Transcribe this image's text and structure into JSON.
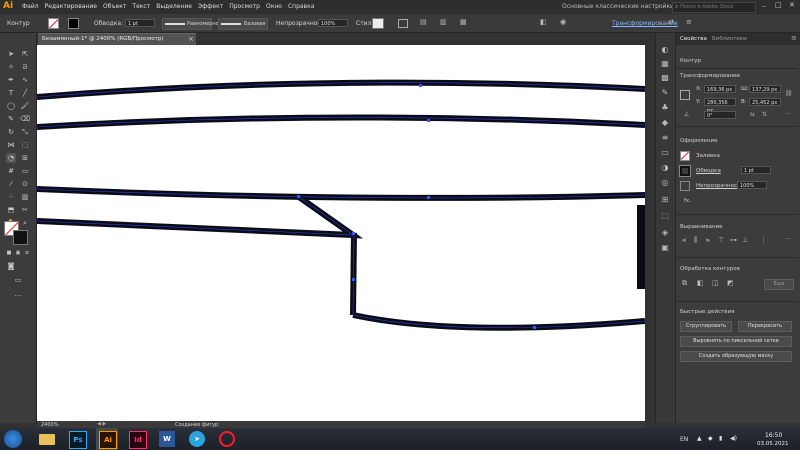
{
  "app": {
    "logo": "Ai",
    "workspace": "Основные классические настройки",
    "search_placeholder": "Поиск в Adobe Stock"
  },
  "menu": [
    "Файл",
    "Редактирование",
    "Объект",
    "Текст",
    "Выделение",
    "Эффект",
    "Просмотр",
    "Окно",
    "Справка"
  ],
  "control_bar": {
    "selection_label": "Контур",
    "stroke_label": "Обводка:",
    "stroke_weight": "1 pt",
    "profile_label": "Равномерно",
    "brush_label": "Базовая",
    "opacity_label": "Непрозрачность:",
    "opacity_value": "100%",
    "style_label": "Стиль:",
    "transform_label": "Трансформирование"
  },
  "document_tab": {
    "title": "Безымянный-1* @ 2400% (RGB/Просмотр)",
    "close": "×"
  },
  "status_bar": {
    "zoom": "2400%",
    "tool": "Создание фигур"
  },
  "panel": {
    "tabs": [
      "Свойства",
      "Библиотеки"
    ],
    "selection": "Контур",
    "transform_title": "Трансформирование",
    "x_label": "X:",
    "x_value": "169,36 px",
    "y_label": "Y:",
    "y_value": "280,356 px",
    "w_label": "Ш:",
    "w_value": "137,29 px",
    "h_label": "В:",
    "h_value": "25,452 px",
    "angle_value": "0°",
    "appearance_title": "Оформление",
    "fill_label": "Заливка",
    "stroke_label": "Обводка",
    "stroke_weight": "1 pt",
    "opacity_label": "Непрозрачность",
    "opacity_value": "100%",
    "fx_label": "fx.",
    "align_title": "Выравнивание",
    "pathfinder_title": "Обработка контуров",
    "pathfinder_extra": "Еще",
    "quick_actions_title": "Быстрые действия",
    "group_button": "Сгруппировать",
    "recolor_button": "Перекрасить",
    "align_pixel_button": "Выровнять по пиксельной сетке",
    "symbol_button": "Создать образующую маску"
  },
  "taskbar": {
    "apps": [
      "Ps",
      "Ai",
      "Id",
      "W"
    ],
    "lang": "EN",
    "time": "16:50",
    "date": "03.05.2021"
  },
  "colors": {
    "ui_dark": "#323232",
    "canvas": "#ffffff",
    "stroke": "#0a0a18",
    "anchor": "#3355ff",
    "ai_orange": "#ff9a00",
    "id_pink": "#ff3366",
    "ps_blue": "#31a8ff"
  }
}
